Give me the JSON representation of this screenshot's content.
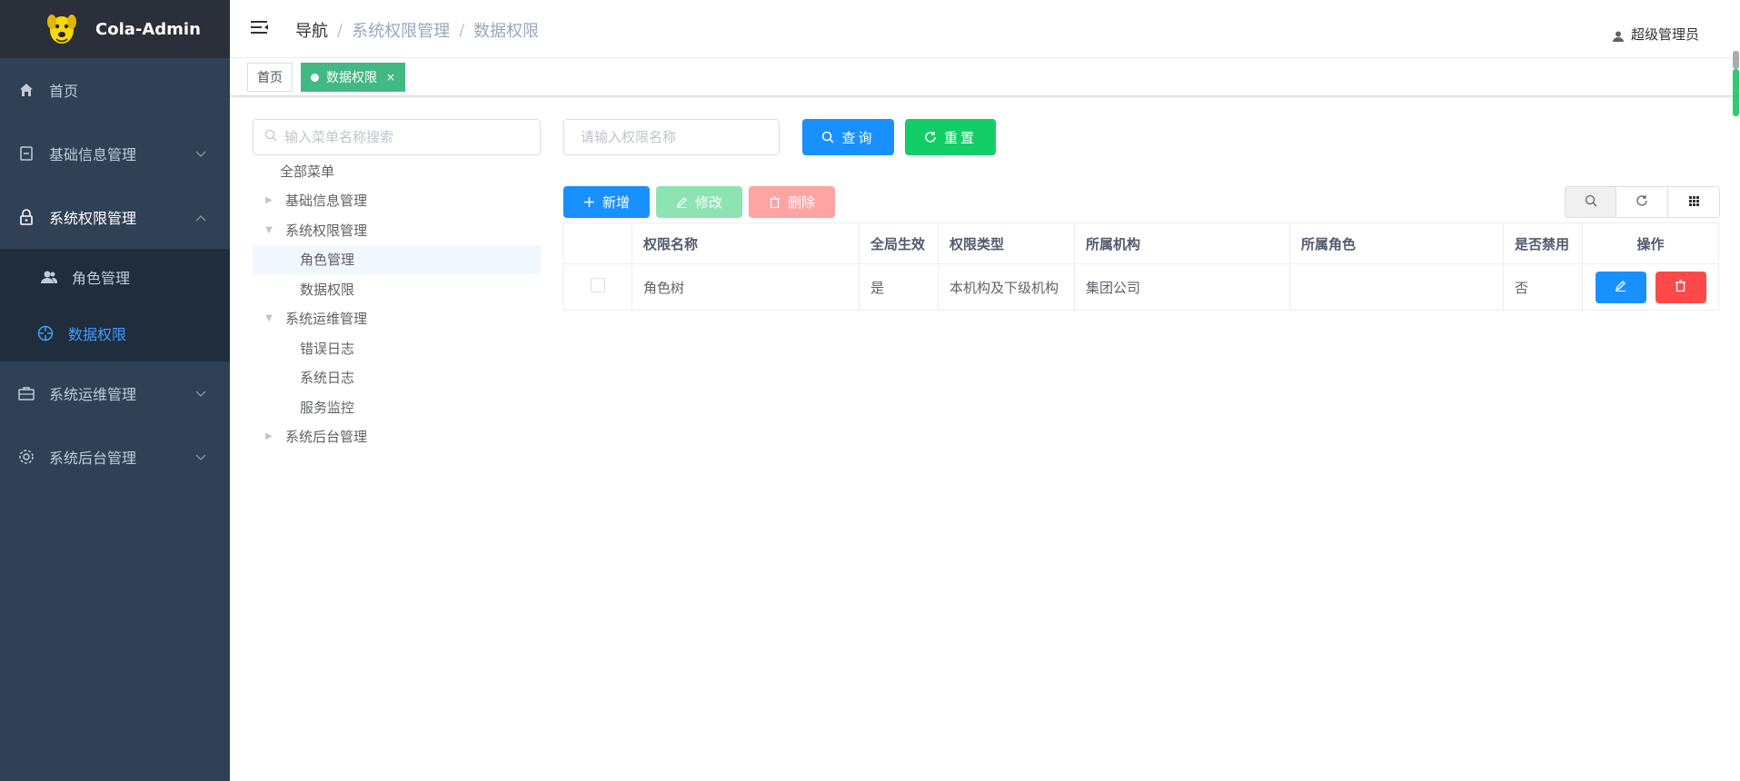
{
  "app": {
    "title": "Cola-Admin"
  },
  "sidebar": {
    "items": [
      {
        "label": "首页",
        "icon": "home-icon"
      },
      {
        "label": "基础信息管理",
        "icon": "document-icon"
      },
      {
        "label": "系统权限管理",
        "icon": "lock-icon"
      },
      {
        "label": "系统运维管理",
        "icon": "toolbox-icon"
      },
      {
        "label": "系统后台管理",
        "icon": "gear-icon"
      }
    ],
    "submenu": [
      {
        "label": "角色管理",
        "icon": "users-icon"
      },
      {
        "label": "数据权限",
        "icon": "crosshair-icon"
      }
    ]
  },
  "header": {
    "breadcrumb": [
      "导航",
      "系统权限管理",
      "数据权限"
    ],
    "user": "超级管理员"
  },
  "tags": {
    "home": "首页",
    "active": "数据权限",
    "close": "×"
  },
  "tree": {
    "search_placeholder": "输入菜单名称搜索",
    "root": "全部菜单",
    "n1": "基础信息管理",
    "n2": "系统权限管理",
    "n2a": "角色管理",
    "n2b": "数据权限",
    "n3": "系统运维管理",
    "n3a": "错误日志",
    "n3b": "系统日志",
    "n3c": "服务监控",
    "n4": "系统后台管理"
  },
  "query": {
    "placeholder": "请输入权限名称",
    "search_label": "查询",
    "reset_label": "重置"
  },
  "toolbar": {
    "add_label": "新增",
    "edit_label": "修改",
    "delete_label": "删除"
  },
  "table": {
    "headers": [
      "权限名称",
      "全局生效",
      "权限类型",
      "所属机构",
      "所属角色",
      "是否禁用",
      "操作"
    ],
    "rows": [
      {
        "name": "角色树",
        "global": "是",
        "type": "本机构及下级机构",
        "org": "集团公司",
        "role": "",
        "disabled": "否"
      }
    ]
  },
  "colors": {
    "sidebar_bg": "#304156",
    "primary": "#1890ff",
    "success": "#13ce66",
    "danger": "#ff4949",
    "tag_active": "#42b983",
    "menu_active": "#409eff"
  }
}
